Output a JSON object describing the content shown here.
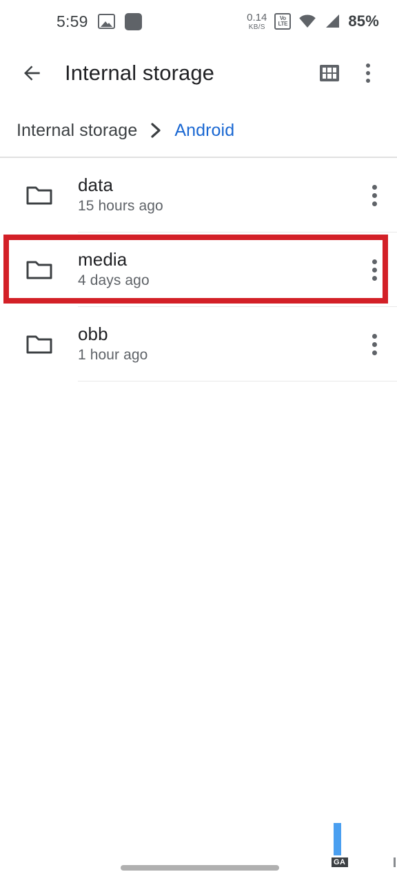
{
  "status_bar": {
    "time": "5:59",
    "icons_left": [
      "photo-icon",
      "app-badge-icon"
    ],
    "net_speed_value": "0.14",
    "net_speed_unit": "KB/S",
    "volte_top": "Vo",
    "volte_bottom": "LTE",
    "icons_right": [
      "volte-icon",
      "wifi-icon",
      "cellular-signal-icon"
    ],
    "battery": "85%"
  },
  "app_bar": {
    "back_icon": "back-arrow-icon",
    "title": "Internal storage",
    "grid_icon": "grid-view-icon",
    "menu_icon": "overflow-menu-icon"
  },
  "breadcrumb": {
    "root": "Internal storage",
    "separator": "chevron-right-icon",
    "current": "Android",
    "active_color": "#1967d2"
  },
  "files": [
    {
      "icon": "folder-icon",
      "name": "data",
      "date": "15 hours ago",
      "menu": "overflow-menu-icon",
      "highlighted": false
    },
    {
      "icon": "folder-icon",
      "name": "media",
      "date": "4 days ago",
      "menu": "overflow-menu-icon",
      "highlighted": true
    },
    {
      "icon": "folder-icon",
      "name": "obb",
      "date": "1 hour ago",
      "menu": "overflow-menu-icon",
      "highlighted": false
    }
  ],
  "annotation": {
    "type": "rectangle-highlight",
    "target": "media",
    "color": "#d32027"
  },
  "overlays": {
    "recorder_badge": "GA",
    "recorder_bar_color": "#4a9ff0"
  },
  "nav": {
    "gesture_bar": "home-gesture-bar"
  }
}
